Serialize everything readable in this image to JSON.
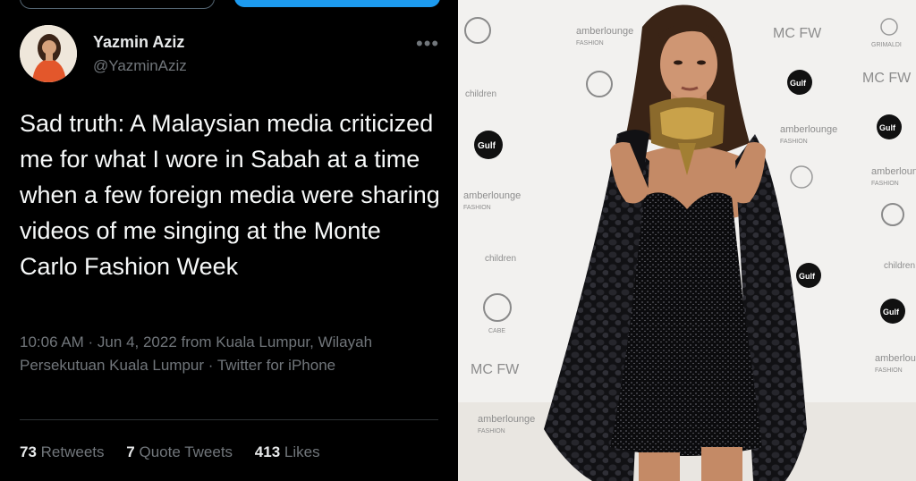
{
  "tweet": {
    "display_name": "Yazmin Aziz",
    "handle": "@YazminAziz",
    "more_icon": "more-horizontal-icon",
    "text": "Sad truth: A Malaysian media criticized me for what I wore in Sabah at a time when a few foreign media were sharing videos of me singing at the Monte Carlo Fashion Week",
    "meta": "10:06 AM · Jun 4, 2022 from Kuala Lumpur, Wilayah Persekutuan Kuala Lumpur · Twitter for iPhone",
    "stats": {
      "retweets_count": "73",
      "retweets_label": "Retweets",
      "quotes_count": "7",
      "quotes_label": "Quote Tweets",
      "likes_count": "413",
      "likes_label": "Likes"
    }
  },
  "photo": {
    "backdrop_logos": {
      "amber": "amberlounge",
      "amber_sub": "FASHION",
      "gulf": "Gulf",
      "mcfw": "MC FW",
      "grimaldi": "GRIMALDI",
      "cabe": "CABE",
      "children": "children"
    }
  },
  "colors": {
    "tweet_bg": "#000000",
    "text_primary": "#e7e9ea",
    "text_secondary": "#71767b",
    "accent": "#1d9bf0",
    "dress": "#0b0b0d",
    "gulf_orange": "#e8772e"
  }
}
